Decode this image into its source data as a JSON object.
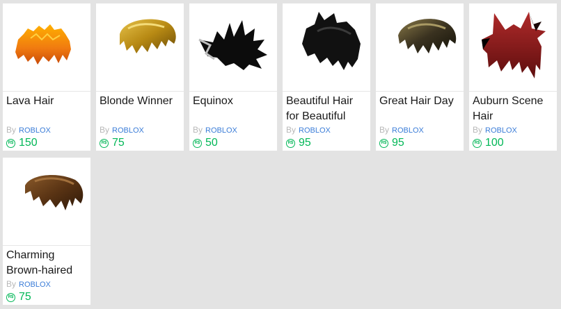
{
  "items": [
    {
      "name": "Lava Hair",
      "by": "By",
      "creator": "ROBLOX",
      "price": "150",
      "icon": "lava-hair-thumbnail-icon"
    },
    {
      "name": "Blonde Winner",
      "by": "By",
      "creator": "ROBLOX",
      "price": "75",
      "icon": "blonde-hair-thumbnail-icon"
    },
    {
      "name": "Equinox",
      "by": "By",
      "creator": "ROBLOX",
      "price": "50",
      "icon": "spiky-black-hair-thumbnail-icon"
    },
    {
      "name": "Beautiful Hair for Beautiful",
      "by": "By",
      "creator": "ROBLOX",
      "price": "95",
      "icon": "black-hair-thumbnail-icon"
    },
    {
      "name": "Great Hair Day",
      "by": "By",
      "creator": "ROBLOX",
      "price": "95",
      "icon": "dark-hair-thumbnail-icon"
    },
    {
      "name": "Auburn Scene Hair",
      "by": "By",
      "creator": "ROBLOX",
      "price": "100",
      "icon": "auburn-hair-thumbnail-icon"
    },
    {
      "name": "Charming Brown-haired",
      "by": "By",
      "creator": "ROBLOX",
      "price": "75",
      "icon": "brown-hair-thumbnail-icon"
    }
  ],
  "colors": {
    "price": "#02b757",
    "creator": "#3b7dd8",
    "background": "#e3e3e3"
  }
}
